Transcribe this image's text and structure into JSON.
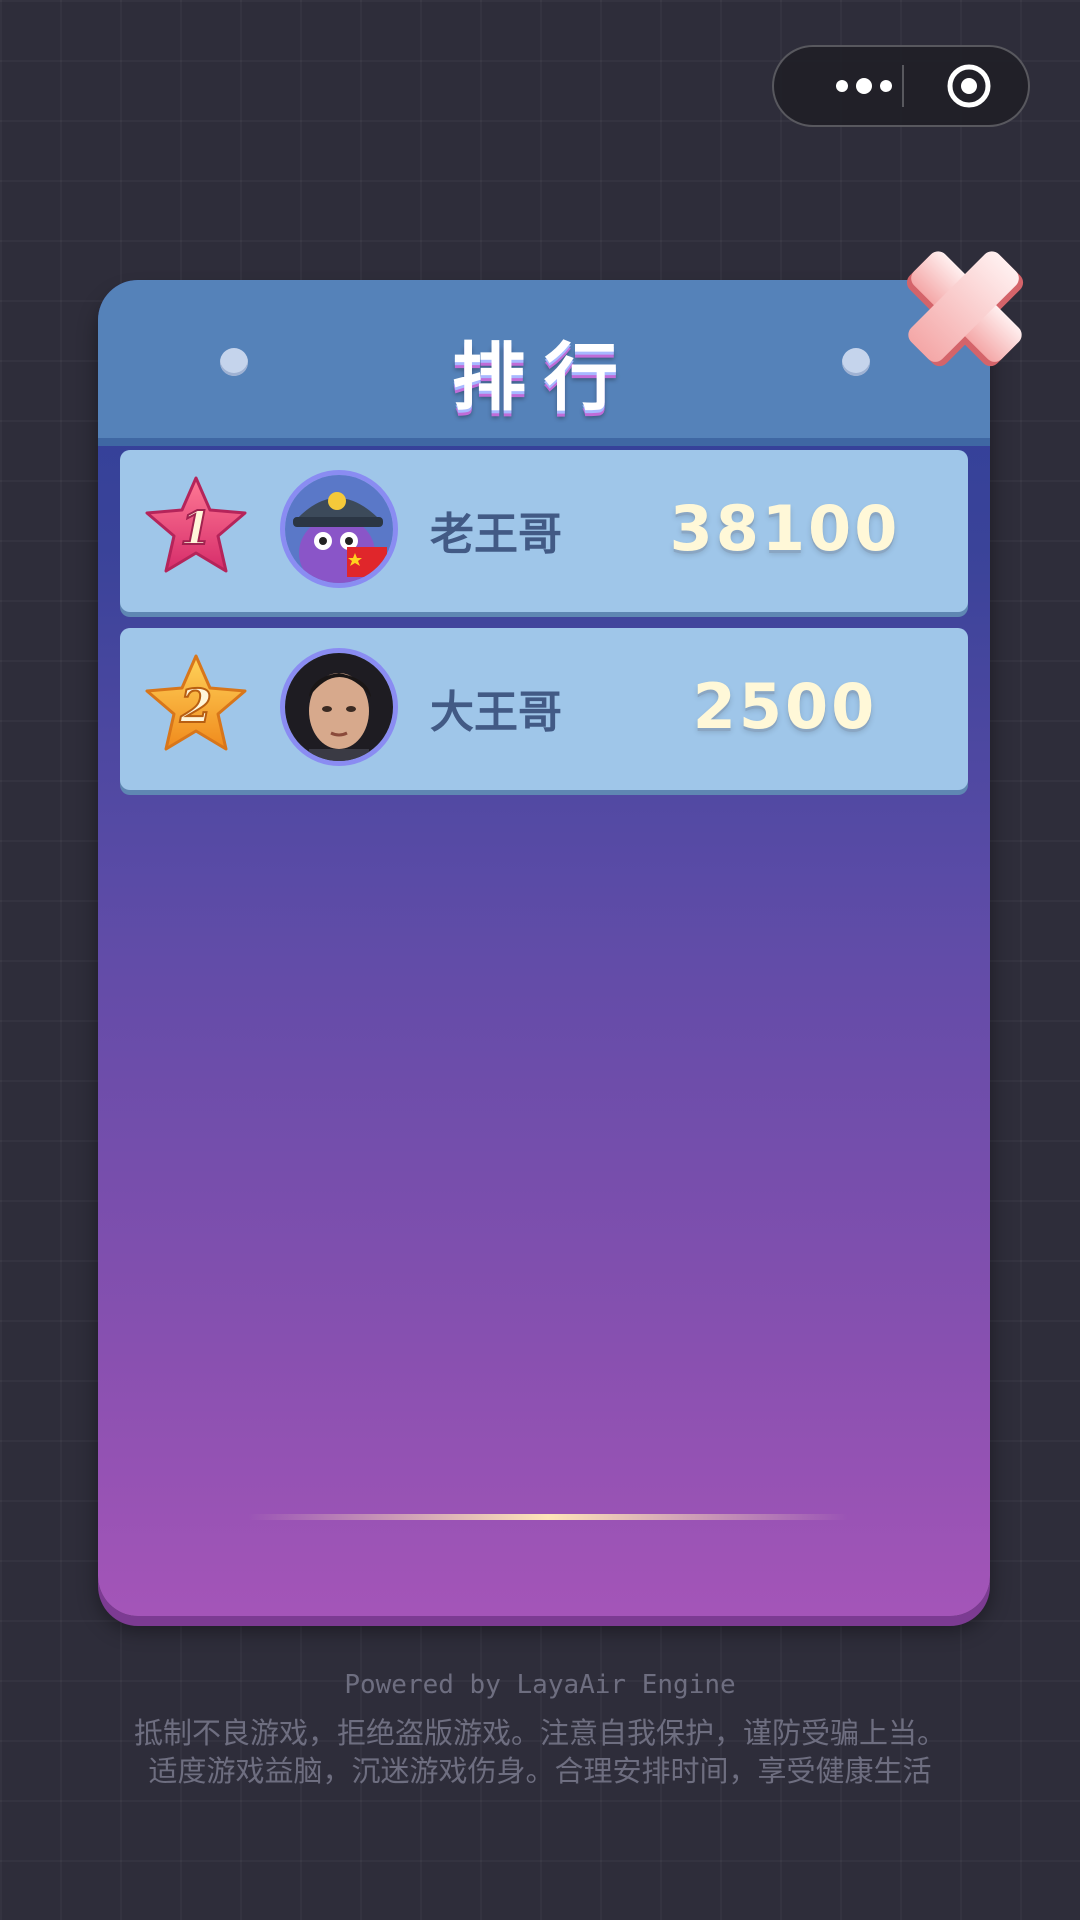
{
  "capsule": {
    "more_icon": "more-dots-icon",
    "target_icon": "target-circle-icon"
  },
  "panel": {
    "title": "排行",
    "close_icon": "close-x-icon"
  },
  "leaderboard": [
    {
      "rank": "1",
      "name": "老王哥",
      "score": "38100",
      "badge_color": "#e8456f",
      "avatar": "cartoon-soldier-avatar"
    },
    {
      "rank": "2",
      "name": "大王哥",
      "score": "2500",
      "badge_color": "#f5a02a",
      "avatar": "photo-avatar"
    }
  ],
  "footer": {
    "powered": "Powered by LayaAir Engine",
    "line1": "抵制不良游戏，拒绝盗版游戏。注意自我保护，谨防受骗上当。",
    "line2": "适度游戏益脑，沉迷游戏伤身。合理安排时间，享受健康生活"
  }
}
